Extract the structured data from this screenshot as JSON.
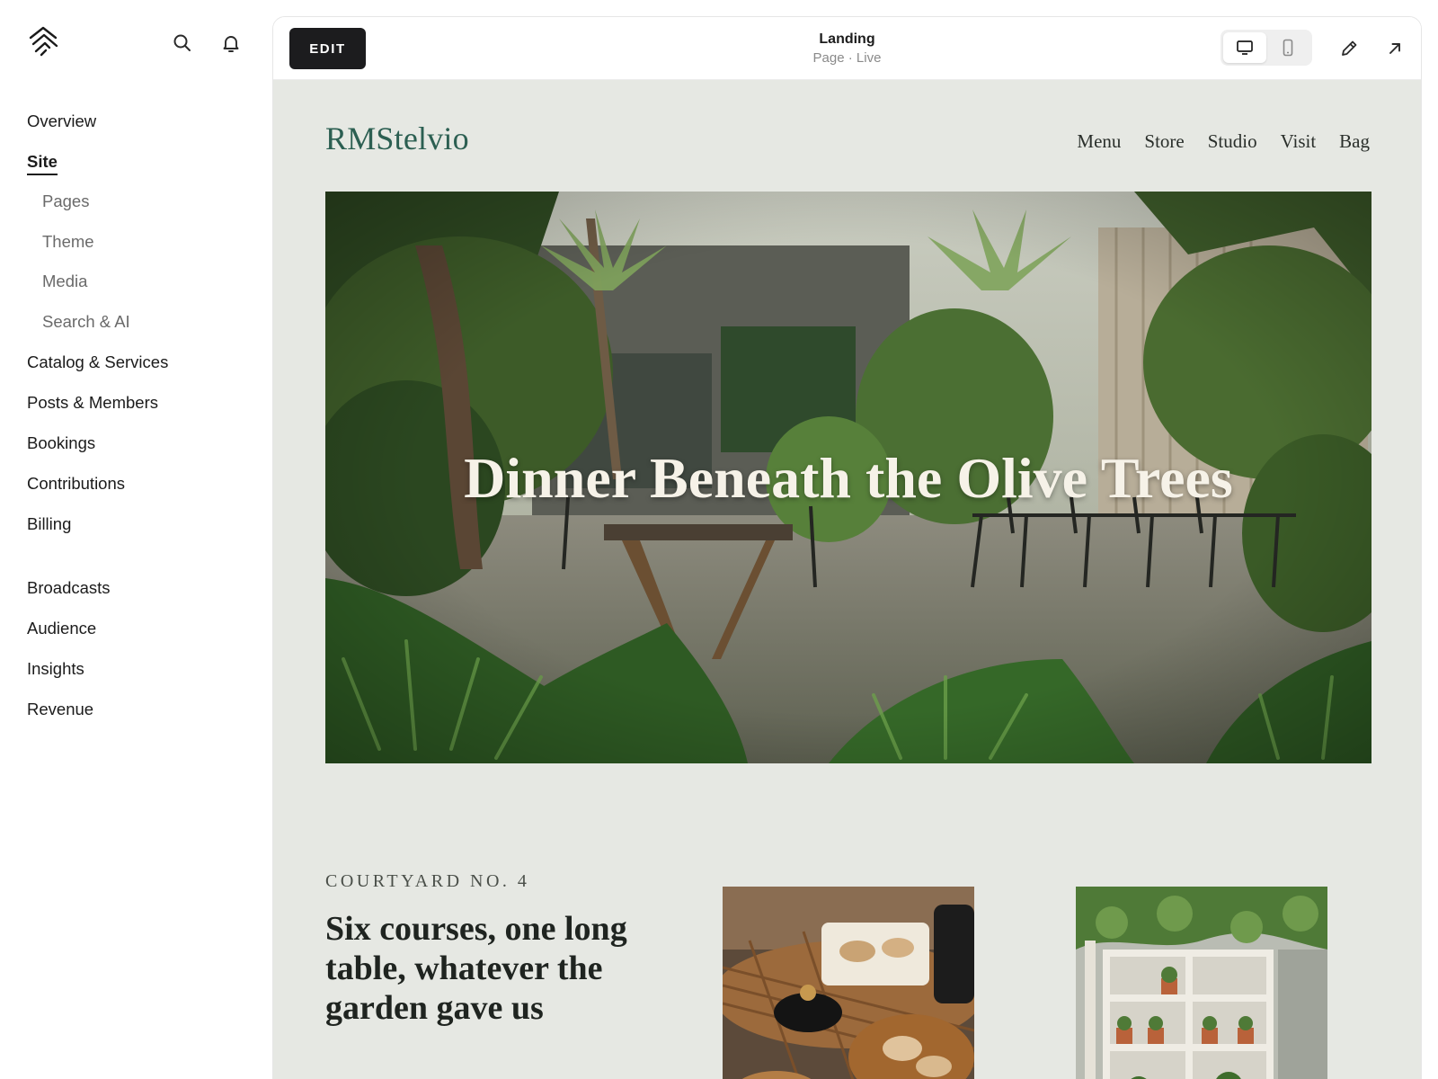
{
  "sidebar": {
    "icons": [
      "logo-icon",
      "search-icon",
      "bell-icon"
    ],
    "items": [
      {
        "label": "Overview"
      },
      {
        "label": "Site",
        "active": true
      },
      {
        "label": "Pages",
        "sub": true
      },
      {
        "label": "Theme",
        "sub": true
      },
      {
        "label": "Media",
        "sub": true
      },
      {
        "label": "Search & AI",
        "sub": true
      },
      {
        "label": "Catalog & Services"
      },
      {
        "label": "Posts & Members"
      },
      {
        "label": "Bookings"
      },
      {
        "label": "Contributions"
      },
      {
        "label": "Billing"
      },
      {
        "label": "Broadcasts"
      },
      {
        "label": "Audience"
      },
      {
        "label": "Insights"
      },
      {
        "label": "Revenue"
      }
    ]
  },
  "toolbar": {
    "edit_label": "EDIT",
    "title": "Landing",
    "subtitle": "Page · Live",
    "device_selected": "desktop",
    "icons": [
      "desktop-icon",
      "mobile-icon",
      "pencil-icon",
      "open-external-icon"
    ]
  },
  "site": {
    "brand": "RMStelvio",
    "nav": [
      "Menu",
      "Store",
      "Studio",
      "Visit",
      "Bag"
    ],
    "hero_title": "Dinner Beneath the Olive Trees",
    "eyebrow": "COURTYARD NO. 4",
    "headline": "Six courses, one long table, whatever the garden gave us"
  },
  "colors": {
    "brand_green": "#2c5f52",
    "canvas_bg": "#e6e8e3",
    "edit_button": "#1c1c1e"
  }
}
